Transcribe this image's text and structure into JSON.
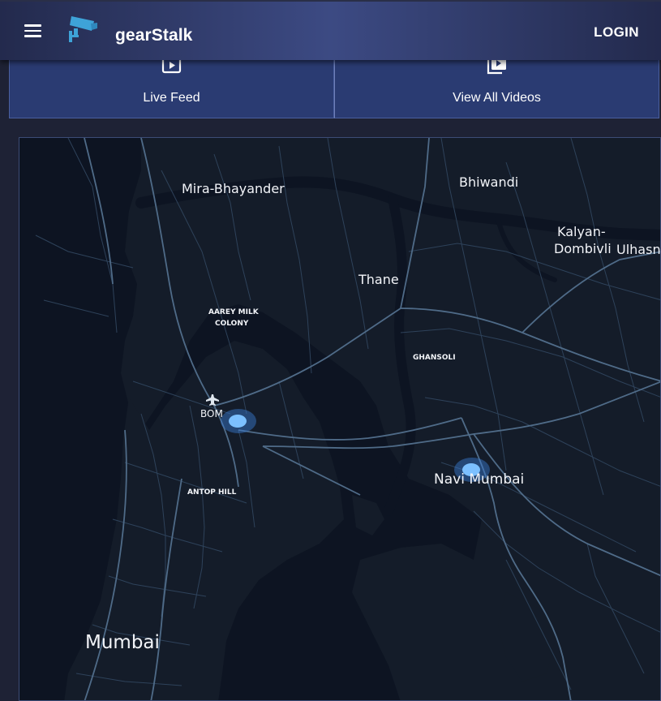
{
  "app": {
    "brand": "gearStalk",
    "login_label": "LOGIN",
    "icons": {
      "menu": "hamburger-menu-icon",
      "logo": "cctv-camera-icon"
    }
  },
  "tabs": [
    {
      "label": "Live Feed",
      "icon": "play-video-icon"
    },
    {
      "label": "View All Videos",
      "icon": "video-library-icon"
    }
  ],
  "map": {
    "theme": "dark",
    "colors": {
      "water": "#0d1422",
      "land": "#141c29",
      "roads": "#3f5a74",
      "major_roads": "#5b7895",
      "marker": "#5fb0ff"
    },
    "labels": {
      "mira_bhayander": "Mira-Bhayander",
      "bhiwandi": "Bhiwandi",
      "kalyan_line1": "Kalyan-",
      "kalyan_line2": "Dombivli",
      "ulhas": "Ulhasn",
      "thane": "Thane",
      "aarey_line1": "AAREY MILK",
      "aarey_line2": "COLONY",
      "ghansoli": "GHANSOLI",
      "bom": "BOM",
      "antop_hill": "ANTOP HILL",
      "navi_mumbai": "Navi Mumbai",
      "mumbai": "Mumbai"
    },
    "markers": [
      {
        "name": "BOM"
      },
      {
        "name": "Navi Mumbai"
      }
    ]
  }
}
